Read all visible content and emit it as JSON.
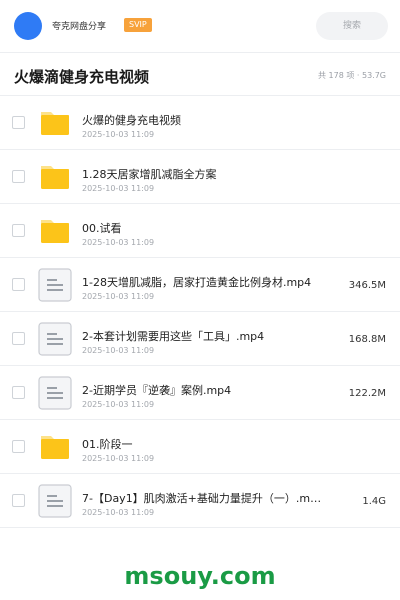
{
  "header": {
    "uploader": "夸克网盘分享",
    "badge": "SVIP",
    "search_placeholder": "搜索"
  },
  "folder": {
    "title": "火爆滴健身充电视频",
    "meta": "共 178 项 · 53.7G"
  },
  "items": [
    {
      "type": "folder",
      "name": "火爆的健身充电视频",
      "date": "2025-10-03 11:09",
      "size": ""
    },
    {
      "type": "folder",
      "name": "1.28天居家增肌减脂全方案",
      "date": "2025-10-03 11:09",
      "size": ""
    },
    {
      "type": "folder",
      "name": "00.试看",
      "date": "2025-10-03 11:09",
      "size": ""
    },
    {
      "type": "file",
      "name": "1-28天增肌减脂，居家打造黄金比例身材.mp4",
      "date": "2025-10-03 11:09",
      "size": "346.5M"
    },
    {
      "type": "file",
      "name": "2-本套计划需要用这些「工具」.mp4",
      "date": "2025-10-03 11:09",
      "size": "168.8M"
    },
    {
      "type": "file",
      "name": "2-近期学员『逆袭』案例.mp4",
      "date": "2025-10-03 11:09",
      "size": "122.2M"
    },
    {
      "type": "folder",
      "name": "01.阶段一",
      "date": "2025-10-03 11:09",
      "size": ""
    },
    {
      "type": "file",
      "name": "7-【Day1】肌肉激活+基础力量提升（一）.m…",
      "date": "2025-10-03 11:09",
      "size": "1.4G"
    }
  ],
  "watermark": "msouy.com",
  "colors": {
    "avatar": "#2f7bf5",
    "badge": "#f7a23b",
    "folder": "#fcc419",
    "watermark": "#1a9b45"
  },
  "icons": {
    "folder": "folder-icon",
    "file": "document-icon"
  }
}
